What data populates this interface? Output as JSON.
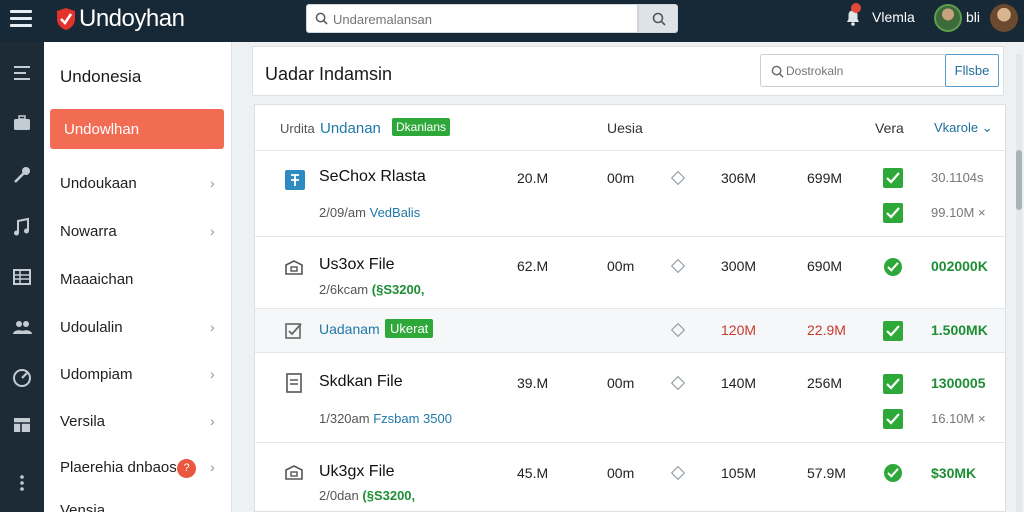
{
  "header": {
    "app_title": "Undoyhan",
    "search_placeholder": "Undaremalansan",
    "user_name": "Vlemla",
    "user_short": "bli"
  },
  "sidebar": {
    "title": "Undonesia",
    "active_item": "Undowlhan",
    "items": [
      {
        "label": "Undoukaan",
        "chevron": true
      },
      {
        "label": "Nowarra",
        "chevron": true
      },
      {
        "label": "Maaaichan",
        "chevron": false
      },
      {
        "label": "Udoulalin",
        "chevron": true
      },
      {
        "label": "Udompiam",
        "chevron": true
      },
      {
        "label": "Versila",
        "chevron": true
      },
      {
        "label": "Plaerehia dnbaos",
        "chevron": true,
        "badge": "?"
      },
      {
        "label": "Vensia",
        "chevron": false
      }
    ]
  },
  "main": {
    "page_title": "Uadar Indamsin",
    "filter_placeholder": "Dostrokaln",
    "filter_button": "Fllsbe",
    "table": {
      "head_prefix": "Urdita",
      "head_link": "Undanan",
      "head_tag": "Dkanlans",
      "head_col_mid": "Uesia",
      "head_col_vera": "Vera",
      "head_dropdown": "Vkarole"
    },
    "rows": [
      {
        "name": "SeChox Rlasta",
        "sub_a": "2/09/am",
        "sub_b": "VedBalis",
        "size": "20.M",
        "time": "00m",
        "v1": "306M",
        "v2": "699M",
        "end1": "30.1104s",
        "end2": "99.10M",
        "end2_extra": "×"
      },
      {
        "name": "Us3ox File",
        "sub_a": "2/6kcam",
        "sub_b": "(§S3200,",
        "size": "62.M",
        "time": "00m",
        "v1": "300M",
        "v2": "690M",
        "end1": "002000K"
      },
      {
        "name": "Uadanam",
        "tag": "Ukerat",
        "v1": "120M",
        "v2": "22.9M",
        "end1": "1.500MK"
      },
      {
        "name": "Skdkan File",
        "sub_a": "1/320am",
        "sub_b": "Fzsbam 3500",
        "size": "39.M",
        "time": "00m",
        "v1": "140M",
        "v2": "256M",
        "end1": "1300005",
        "end2": "16.10M",
        "end2_extra": "×"
      },
      {
        "name": "Uk3gx File",
        "sub_a": "2/0dan",
        "sub_b": "(§S3200,",
        "size": "45.M",
        "time": "00m",
        "v1": "105M",
        "v2": "57.9M",
        "end1": "$30MK"
      }
    ]
  },
  "colors": {
    "topbar": "#172836",
    "accent": "#f26b53",
    "success": "#2fa83a",
    "link": "#1f78a8"
  }
}
